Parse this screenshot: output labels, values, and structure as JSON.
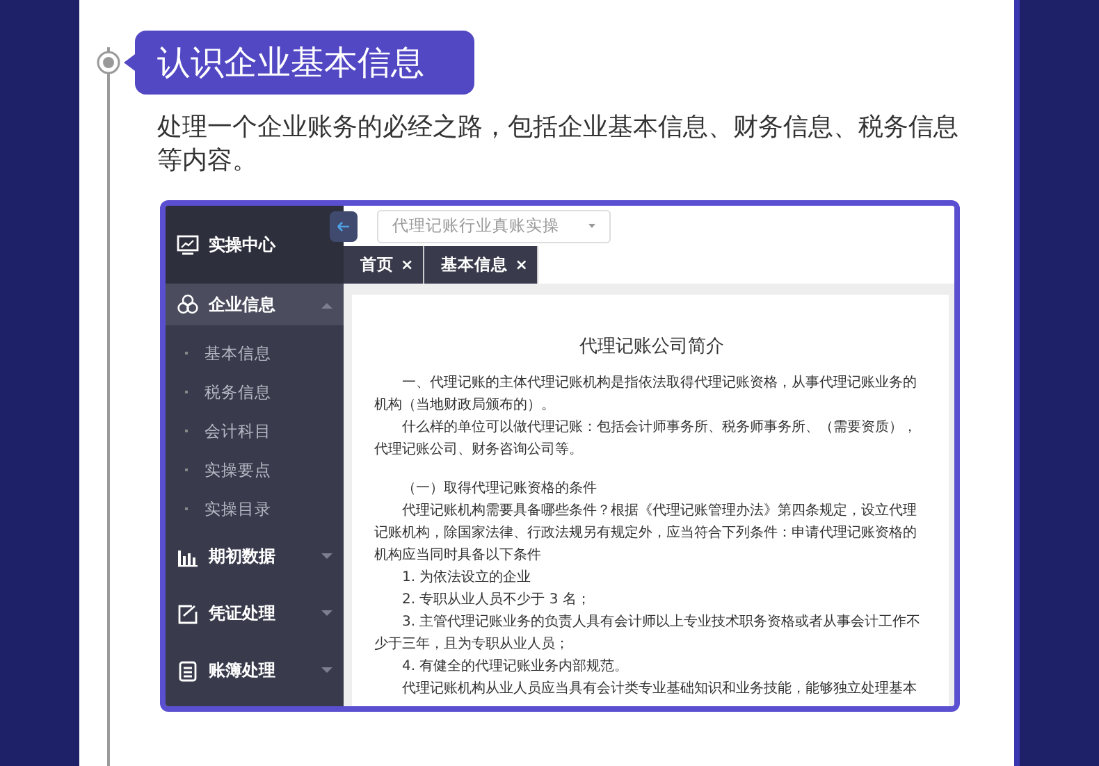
{
  "heading": "认识企业基本信息",
  "description": "处理一个企业账务的必经之路，包括企业基本信息、财务信息、税务信息等内容。",
  "app": {
    "sidebar": {
      "items": [
        {
          "kind": "header",
          "label": "实操中心"
        },
        {
          "kind": "group",
          "label": "企业信息",
          "expanded": true,
          "selected": true,
          "children": [
            {
              "label": "基本信息"
            },
            {
              "label": "税务信息"
            },
            {
              "label": "会计科目"
            },
            {
              "label": "实操要点"
            },
            {
              "label": "实操目录"
            }
          ]
        },
        {
          "kind": "group",
          "label": "期初数据",
          "expanded": false,
          "selected": false
        },
        {
          "kind": "group",
          "label": "凭证处理",
          "expanded": false,
          "selected": false
        },
        {
          "kind": "group",
          "label": "账簿处理",
          "expanded": false,
          "selected": false
        }
      ]
    },
    "select": {
      "value": "代理记账行业真账实操"
    },
    "tabs": [
      {
        "label": "首页",
        "close": "×"
      },
      {
        "label": "基本信息",
        "close": "×"
      }
    ],
    "document": {
      "title": "代理记账公司简介",
      "paragraphs": [
        {
          "kind": "text",
          "text": "一、代理记账的主体代理记账机构是指依法取得代理记账资格，从事代理记账业务的机构（当地财政局颁布的）。"
        },
        {
          "kind": "text",
          "text": "什么样的单位可以做代理记账：包括会计师事务所、税务师事务所、（需要资质），代理记账公司、财务咨询公司等。"
        },
        {
          "kind": "gap"
        },
        {
          "kind": "text",
          "text": "（一）取得代理记账资格的条件"
        },
        {
          "kind": "text",
          "text": "代理记账机构需要具备哪些条件？根据《代理记账管理办法》第四条规定，设立代理记账机构，除国家法律、行政法规另有规定外，应当符合下列条件：申请代理记账资格的机构应当同时具备以下条件"
        },
        {
          "kind": "text",
          "text": "1. 为依法设立的企业"
        },
        {
          "kind": "text",
          "text": "2. 专职从业人员不少于 3 名；"
        },
        {
          "kind": "text",
          "text": "3. 主管代理记账业务的负责人具有会计师以上专业技术职务资格或者从事会计工作不少于三年，且为专职从业人员；"
        },
        {
          "kind": "text",
          "text": "4. 有健全的代理记账业务内部规范。"
        },
        {
          "kind": "text",
          "text": "代理记账机构从业人员应当具有会计类专业基础知识和业务技能，能够独立处理基本"
        }
      ]
    }
  }
}
